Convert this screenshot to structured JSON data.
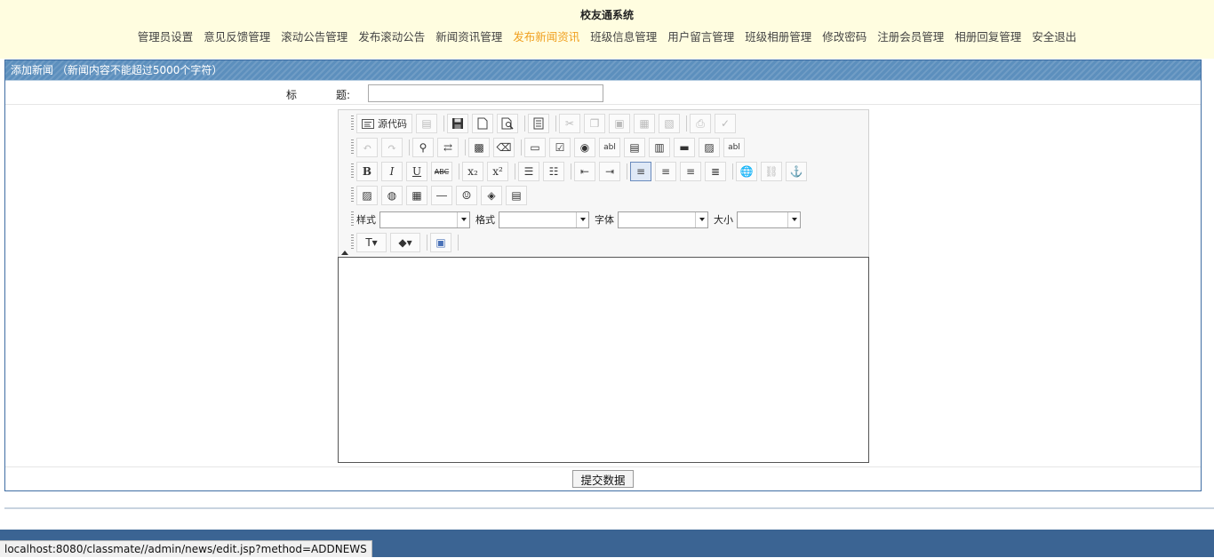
{
  "header": {
    "site_title": "校友通系统",
    "nav": [
      {
        "label": "管理员设置"
      },
      {
        "label": "意见反馈管理"
      },
      {
        "label": "滚动公告管理"
      },
      {
        "label": "发布滚动公告"
      },
      {
        "label": "新闻资讯管理"
      },
      {
        "label": "发布新闻资讯"
      },
      {
        "label": "班级信息管理"
      },
      {
        "label": "用户留言管理"
      },
      {
        "label": "班级相册管理"
      },
      {
        "label": "修改密码"
      },
      {
        "label": "注册会员管理"
      },
      {
        "label": "相册回复管理"
      },
      {
        "label": "安全退出"
      }
    ],
    "active_nav": "发布新闻资讯",
    "active_color": "#f0a020"
  },
  "panel": {
    "heading": "添加新闻 （新闻内容不能超过5000个字符）",
    "title_label_1": "标",
    "title_label_2": "题:",
    "title_value": "",
    "submit_label": "提交数据",
    "header_color": "#5c8fbd"
  },
  "editor": {
    "source_button": "源代码",
    "combos": {
      "style_label": "样式",
      "format_label": "格式",
      "font_label": "字体",
      "size_label": "大小",
      "style_value": "",
      "format_value": "",
      "font_value": "",
      "size_value": ""
    },
    "icons": {
      "bold": "B",
      "italic": "I",
      "underline": "U",
      "strike": "ABC",
      "text_field": "abl"
    }
  },
  "status_bar": {
    "url": "localhost:8080/classmate//admin/news/edit.jsp?method=ADDNEWS"
  }
}
